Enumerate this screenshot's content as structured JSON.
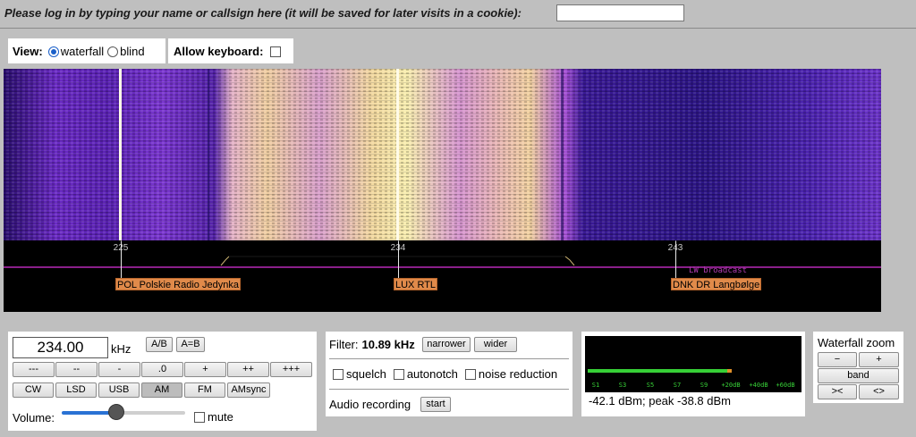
{
  "login": {
    "prompt": "Please log in by typing your name or callsign here (it will be saved for later visits in a cookie):",
    "value": ""
  },
  "view": {
    "label": "View:",
    "options": [
      "waterfall",
      "blind"
    ],
    "selected": "waterfall"
  },
  "keyboard": {
    "label": "Allow keyboard:",
    "checked": false
  },
  "scale": {
    "ticks": [
      "225",
      "234",
      "243"
    ],
    "band_label": "LW broadcast"
  },
  "stations": [
    {
      "label": "POL Polskie Radio Jedynka"
    },
    {
      "label": "LUX RTL"
    },
    {
      "label": "DNK DR Langbølge"
    }
  ],
  "frequency": {
    "value": "234.00",
    "unit": "kHz",
    "ab_label": "A/B",
    "a_eq_b_label": "A=B"
  },
  "step_buttons": [
    "---",
    "--",
    "-",
    ".0",
    "+",
    "++",
    "+++"
  ],
  "modes": {
    "items": [
      "CW",
      "LSD",
      "USB",
      "AM",
      "FM",
      "AMsync"
    ],
    "active": "AM"
  },
  "volume": {
    "label": "Volume:",
    "level": 0.5,
    "mute_label": "mute",
    "muted": false
  },
  "filter": {
    "label": "Filter:",
    "value": "10.89 kHz",
    "narrower_label": "narrower",
    "wider_label": "wider",
    "options": [
      {
        "label": "squelch",
        "checked": false
      },
      {
        "label": "autonotch",
        "checked": false
      },
      {
        "label": "noise reduction",
        "checked": false
      }
    ]
  },
  "recording": {
    "label": "Audio recording",
    "button": "start"
  },
  "smeter": {
    "readout_level": "-42.1 dBm;",
    "readout_peak": "peak  -38.8 dBm",
    "level_fraction": 0.66,
    "scale": [
      "S1",
      "S3",
      "S5",
      "S7",
      "S9",
      "+20dB",
      "+40dB",
      "+60dB"
    ],
    "colors": {
      "bar": "#37d037",
      "peak": "#e0902a"
    }
  },
  "zoom": {
    "title": "Waterfall zoom",
    "minus": "−",
    "plus": "+",
    "band": "band",
    "in": ">< ",
    "out": "<>"
  }
}
